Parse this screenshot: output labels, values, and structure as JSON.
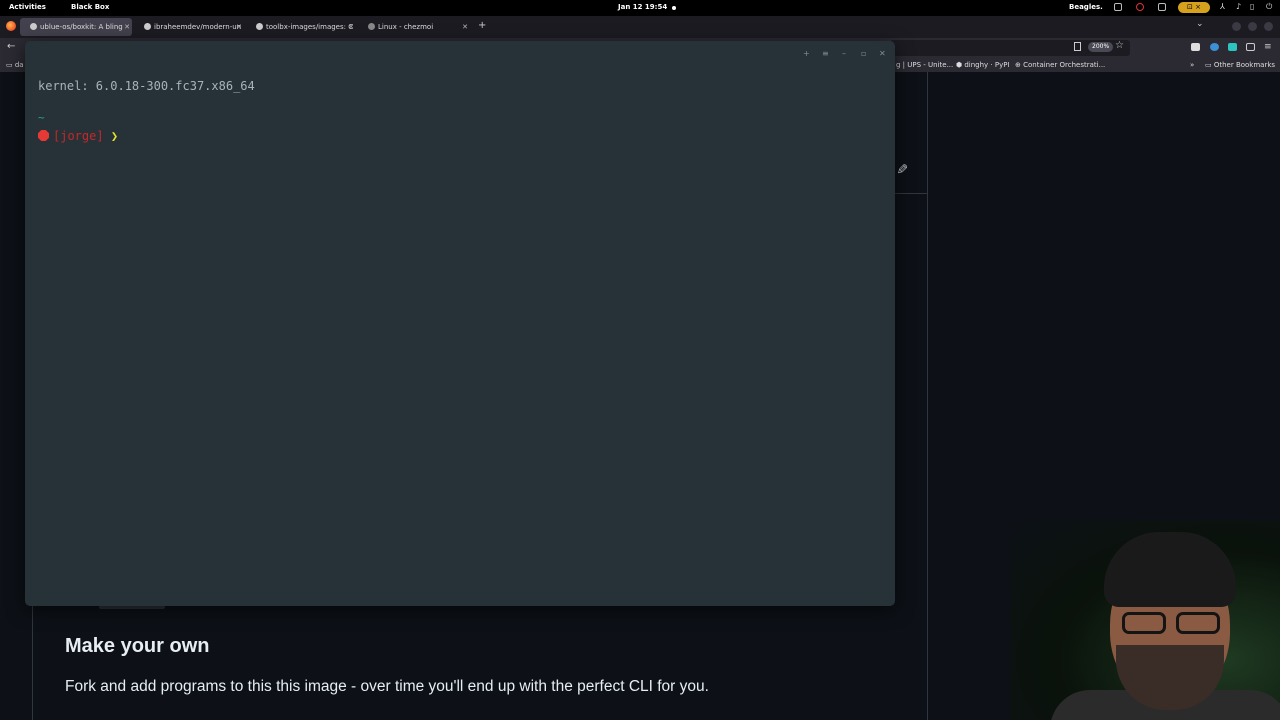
{
  "topbar": {
    "activities": "Activities",
    "app": "Black Box",
    "clock": "Jan 12  19:54",
    "user": "Beagles."
  },
  "browser": {
    "tabs": [
      {
        "label": "ublue-os/boxkit: A bling",
        "active": true
      },
      {
        "label": "ibraheemdev/modern-un",
        "active": false
      },
      {
        "label": "toolbx-images/images: C",
        "active": false
      },
      {
        "label": "Linux - chezmoi",
        "active": false
      }
    ],
    "zoom": "200%",
    "bookmarks": [
      {
        "label": "da"
      },
      {
        "label": "g | UPS - Unite..."
      },
      {
        "label": "dinghy · PyPI"
      },
      {
        "label": "Container Orchestrati..."
      },
      {
        "label": "Other Bookmarks"
      }
    ]
  },
  "terminal": {
    "kernel_line": "kernel: 6.0.18-300.fc37.x86_64",
    "cwd": "~",
    "user": "[jorge]",
    "prompt_symbol": "❯"
  },
  "page": {
    "heading": "Make your own",
    "paragraph": "Fork and add programs to this this image - over time you'll end up with the perfect CLI for you."
  },
  "colors": {
    "terminal_bg": "#263238",
    "prompt_red": "#c62828",
    "prompt_arrow": "#e6e22e",
    "cwd_teal": "#26a69a",
    "page_bg": "#0d1117"
  }
}
